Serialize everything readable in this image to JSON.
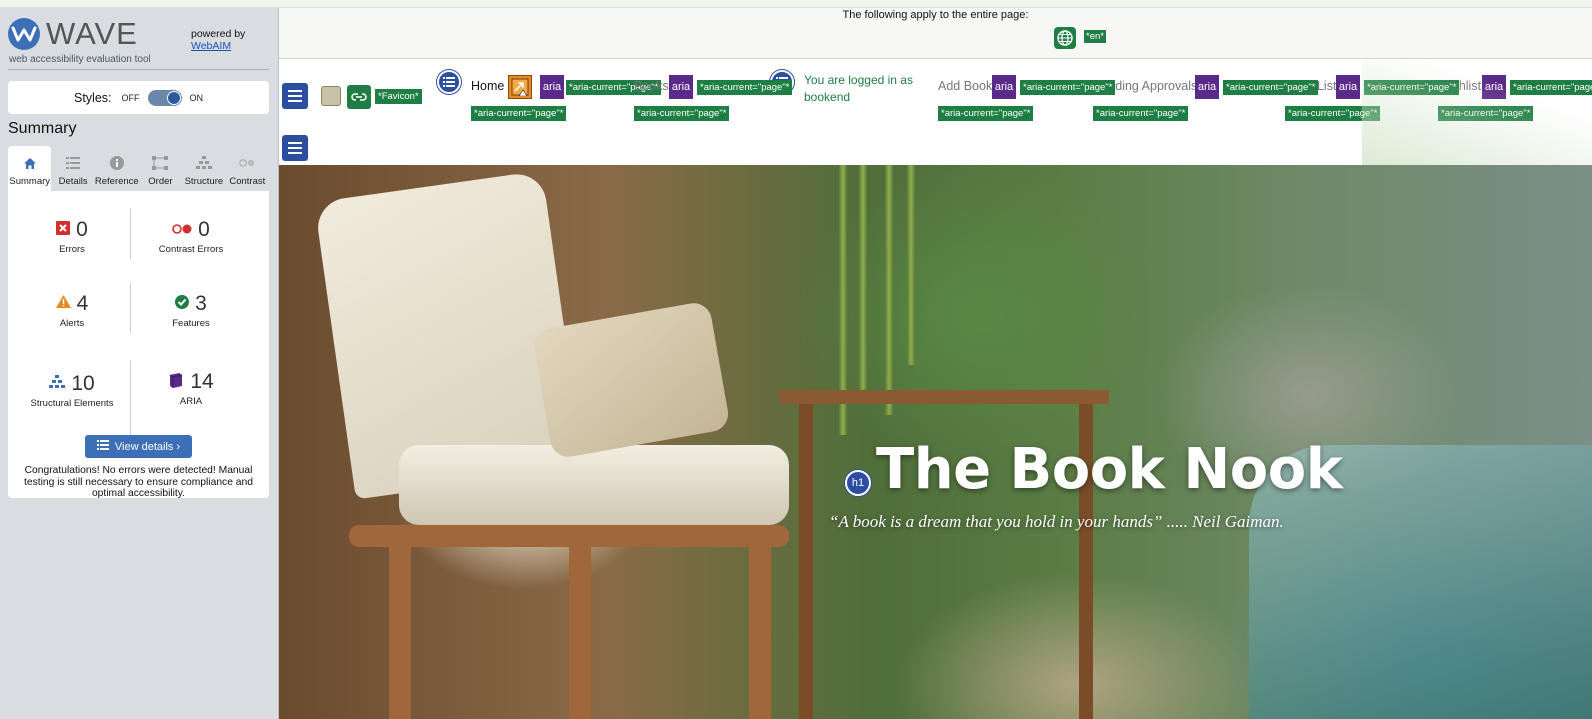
{
  "wave": {
    "brand": "WAVE",
    "tagline": "web accessibility evaluation tool",
    "powered_by": "powered by",
    "powered_link": "WebAIM",
    "styles_label": "Styles:",
    "styles_off": "OFF",
    "styles_on": "ON",
    "styles_state": "on",
    "summary_title": "Summary",
    "tabs": [
      {
        "label": "Summary",
        "icon": "home-icon",
        "active": true
      },
      {
        "label": "Details",
        "icon": "list-icon",
        "active": false
      },
      {
        "label": "Reference",
        "icon": "info-icon",
        "active": false
      },
      {
        "label": "Order",
        "icon": "order-icon",
        "active": false
      },
      {
        "label": "Structure",
        "icon": "structure-icon",
        "active": false
      },
      {
        "label": "Contrast",
        "icon": "contrast-icon",
        "active": false
      }
    ],
    "stats": {
      "errors": {
        "value": "0",
        "label": "Errors"
      },
      "contrast_errors": {
        "value": "0",
        "label": "Contrast Errors"
      },
      "alerts": {
        "value": "4",
        "label": "Alerts"
      },
      "features": {
        "value": "3",
        "label": "Features"
      },
      "structural": {
        "value": "10",
        "label": "Structural Elements"
      },
      "aria": {
        "value": "14",
        "label": "ARIA"
      }
    },
    "view_details": "View details ›",
    "congrats": "Congratulations! No errors were detected! Manual testing is still necessary to ensure compliance and optimal accessibility."
  },
  "page": {
    "page_level_text": "The following apply to the entire page:",
    "lang_tag": "*en*",
    "favicon_tag": "*Favicon*",
    "aria_label": "aria",
    "aria_current_tag": "*aria-current=\"page\"*",
    "nav": {
      "home": "Home",
      "books": "Books",
      "status": "You are logged in as bookend",
      "add_book": "Add Book",
      "pending": "Pending Approvals",
      "book_list": "Book List",
      "wishlist": "Wishlist"
    },
    "hero_title": "The Book Nook",
    "hero_quote": "“A book is a dream that you hold in your hands” ..... Neil Gaiman.",
    "h1_badge": "h1"
  },
  "colors": {
    "wave_blue": "#3d6fb6",
    "feature_green": "#1e7e43",
    "aria_purple": "#5a2a8a",
    "alert_orange": "#e58b25",
    "error_red": "#d0312d"
  }
}
